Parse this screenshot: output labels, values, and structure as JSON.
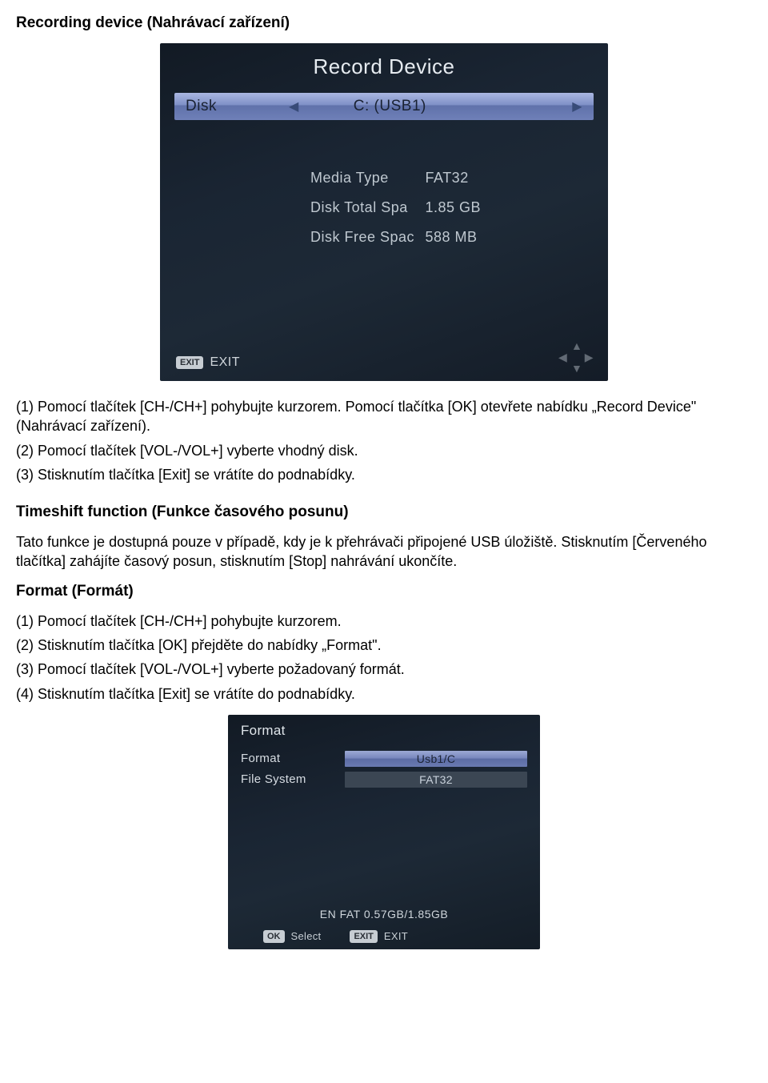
{
  "section1": {
    "heading": "Recording device (Nahrávací zařízení)",
    "p1": "(1) Pomocí tlačítek [CH-/CH+] pohybujte kurzorem. Pomocí tlačítka [OK] otevřete nabídku „Record Device\" (Nahrávací zařízení).",
    "p2": "(2) Pomocí tlačítek [VOL-/VOL+] vyberte vhodný disk.",
    "p3": "(3) Stisknutím tlačítka [Exit] se vrátíte do podnabídky."
  },
  "section2": {
    "heading": "Timeshift function (Funkce časového posunu)",
    "p1": "Tato funkce je dostupná pouze v případě, kdy je k přehrávači připojené USB úložiště. Stisknutím [Červeného tlačítka] zahájíte časový posun, stisknutím [Stop] nahrávání ukončíte."
  },
  "section3": {
    "heading": "Format (Formát)",
    "p1": "(1) Pomocí tlačítek [CH-/CH+] pohybujte kurzorem.",
    "p2": "(2) Stisknutím tlačítka [OK] přejděte do nabídky „Format\".",
    "p3": "(3) Pomocí tlačítek [VOL-/VOL+] vyberte požadovaný formát.",
    "p4": "(4) Stisknutím tlačítka [Exit] se vrátíte do podnabídky."
  },
  "shot1": {
    "title": "Record Device",
    "disk_label": "Disk",
    "disk_value": "C: (USB1)",
    "media_type_label": "Media Type",
    "media_type_value": "FAT32",
    "total_label": "Disk Total Spa",
    "total_value": "1.85 GB",
    "free_label": "Disk Free Spac",
    "free_value": "588 MB",
    "exit_btn": "EXIT",
    "exit_label": "EXIT"
  },
  "shot2": {
    "title": "Format",
    "row1_label": "Format",
    "row1_value": "Usb1/C",
    "row2_label": "File System",
    "row2_value": "FAT32",
    "status": "EN FAT   0.57GB/1.85GB",
    "ok_btn": "OK",
    "ok_label": "Select",
    "exit_btn": "EXIT",
    "exit_label": "EXIT"
  }
}
